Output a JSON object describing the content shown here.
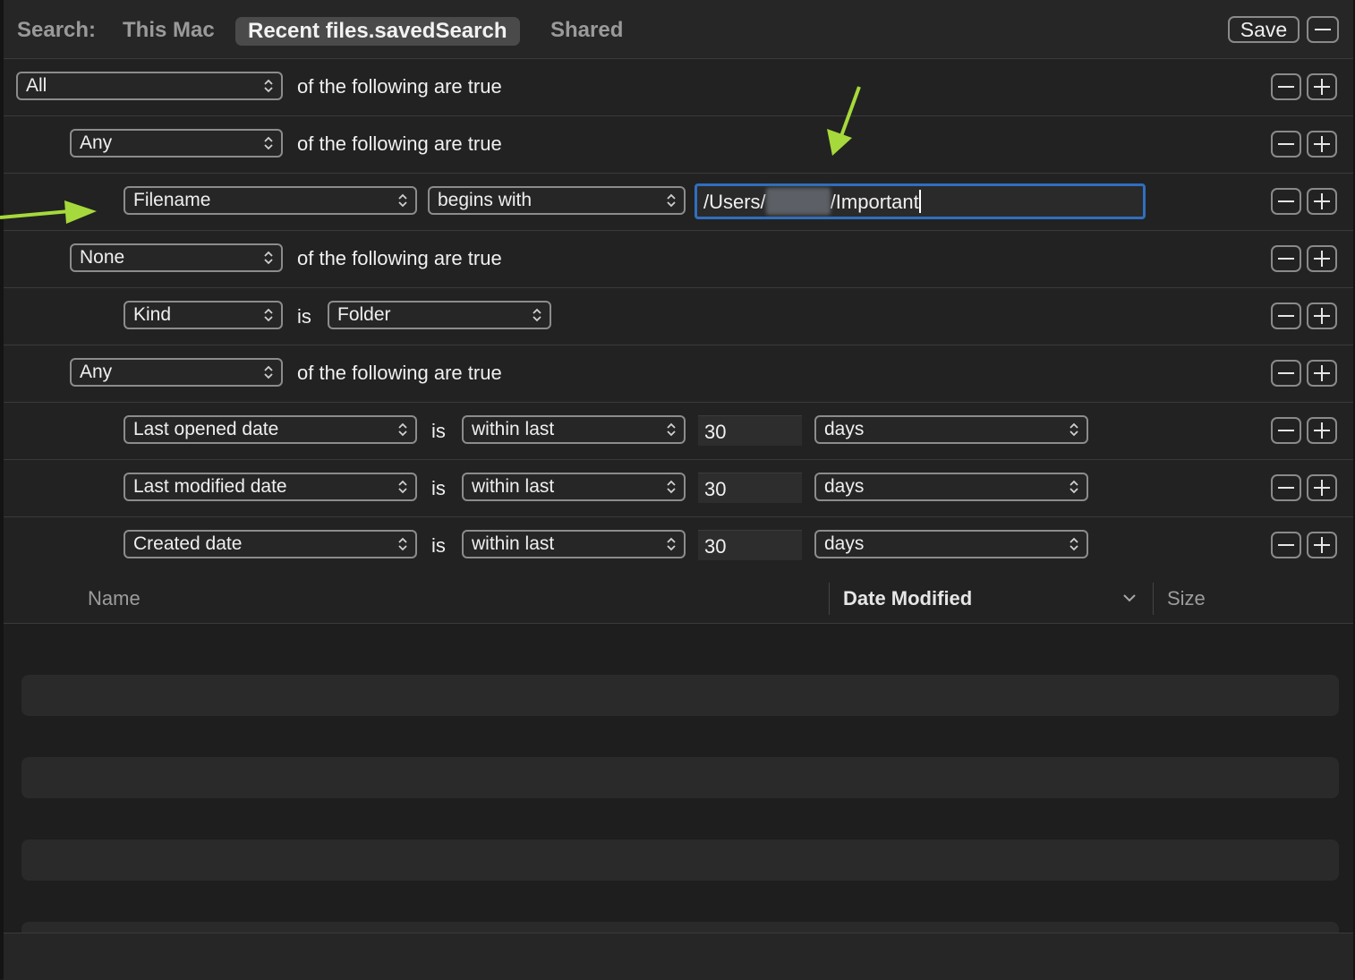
{
  "scope": {
    "label": "Search:",
    "options": [
      "This Mac",
      "Recent files.savedSearch",
      "Shared"
    ],
    "selected": "Recent files.savedSearch",
    "save_label": "Save"
  },
  "rules": {
    "r1": {
      "qualifier": "All",
      "text": "of the following are true"
    },
    "r2": {
      "qualifier": "Any",
      "text": "of the following are true"
    },
    "r3": {
      "attribute": "Filename",
      "operator": "begins with",
      "value_prefix": "/Users/",
      "value_suffix": "/Important"
    },
    "r4": {
      "qualifier": "None",
      "text": "of the following are true"
    },
    "r5": {
      "attribute": "Kind",
      "operator": "is",
      "value": "Folder"
    },
    "r6": {
      "qualifier": "Any",
      "text": "of the following are true"
    },
    "r7": {
      "attribute": "Last opened date",
      "is": "is",
      "operator": "within last",
      "number": "30",
      "unit": "days"
    },
    "r8": {
      "attribute": "Last modified date",
      "is": "is",
      "operator": "within last",
      "number": "30",
      "unit": "days"
    },
    "r9": {
      "attribute": "Created date",
      "is": "is",
      "operator": "within last",
      "number": "30",
      "unit": "days"
    }
  },
  "columns": {
    "name": "Name",
    "date_modified": "Date Modified",
    "size": "Size"
  },
  "colors": {
    "accent": "#2f6fbf",
    "annotation_arrow": "#a6d93b"
  },
  "icons": [
    "minus-icon",
    "plus-icon",
    "updown-chevron-icon",
    "chevron-down-icon",
    "annotation-arrow"
  ]
}
